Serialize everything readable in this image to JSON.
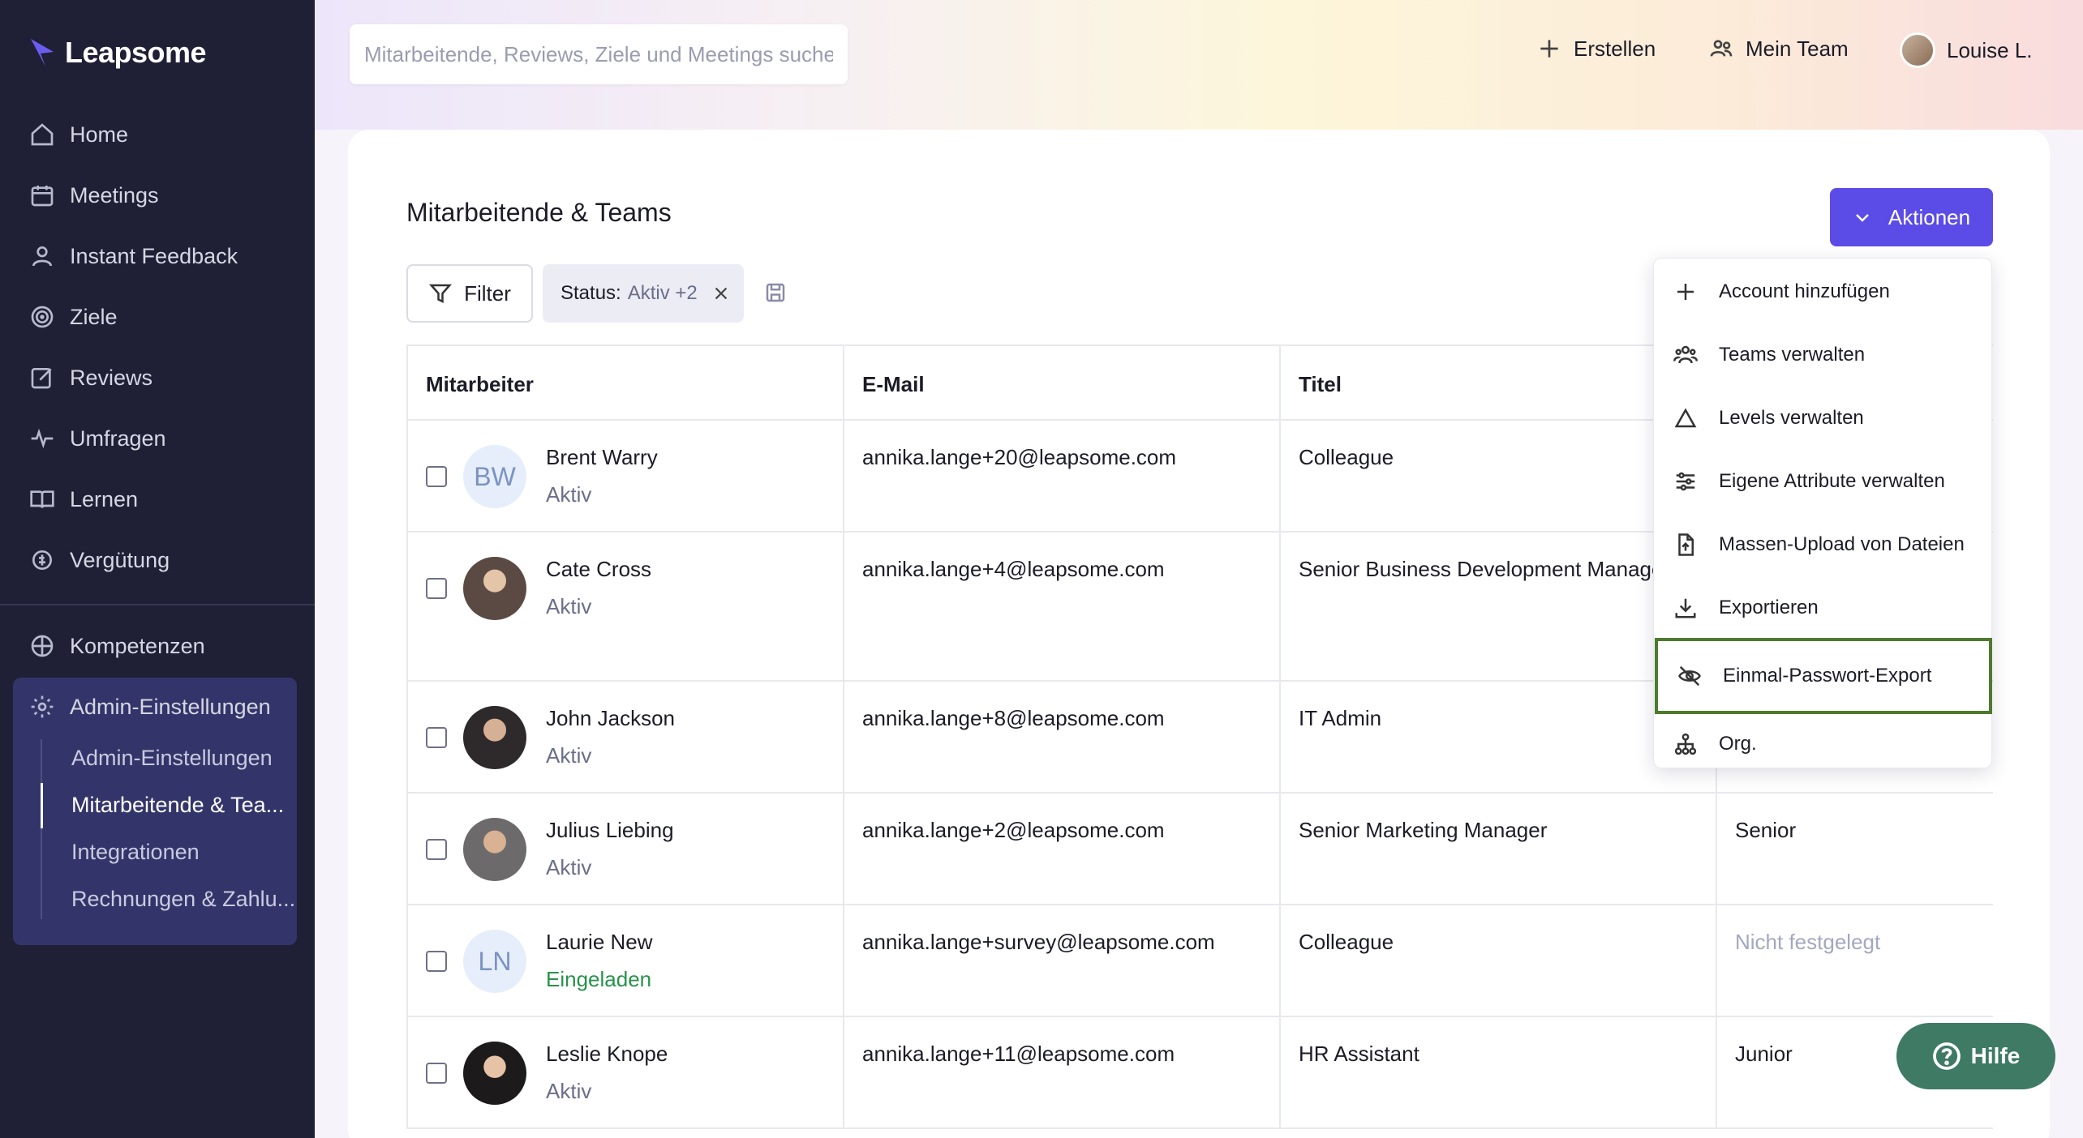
{
  "brand": {
    "name": "Leapsome"
  },
  "sidebar": {
    "items": [
      {
        "label": "Home"
      },
      {
        "label": "Meetings"
      },
      {
        "label": "Instant Feedback"
      },
      {
        "label": "Ziele"
      },
      {
        "label": "Reviews"
      },
      {
        "label": "Umfragen"
      },
      {
        "label": "Lernen"
      },
      {
        "label": "Vergütung"
      },
      {
        "label": "Kompetenzen"
      },
      {
        "label": "Admin-Einstellungen"
      }
    ],
    "sub_items": [
      {
        "label": "Admin-Einstellungen"
      },
      {
        "label": "Mitarbeitende & Tea..."
      },
      {
        "label": "Integrationen"
      },
      {
        "label": "Rechnungen & Zahlu..."
      }
    ]
  },
  "topbar": {
    "search_placeholder": "Mitarbeitende, Reviews, Ziele und Meetings suchen",
    "create_label": "Erstellen",
    "team_label": "Mein Team",
    "user_label": "Louise L."
  },
  "page": {
    "title": "Mitarbeitende & Teams",
    "actions_label": "Aktionen",
    "filter_label": "Filter",
    "chip_key": "Status:",
    "chip_value": "Aktiv +2"
  },
  "table": {
    "headers": [
      "Mitarbeiter",
      "E-Mail",
      "Titel"
    ],
    "rows": [
      {
        "initials": "BW",
        "name": "Brent Warry",
        "status": "Aktiv",
        "email": "annika.lange+20@leapsome.com",
        "title": "Colleague",
        "level": ""
      },
      {
        "initials": "",
        "name": "Cate Cross",
        "status": "Aktiv",
        "email": "annika.lange+4@leapsome.com",
        "title": "Senior Business Development Manager",
        "level": ""
      },
      {
        "initials": "",
        "name": "John Jackson",
        "status": "Aktiv",
        "email": "annika.lange+8@leapsome.com",
        "title": "IT Admin",
        "level": ""
      },
      {
        "initials": "",
        "name": "Julius Liebing",
        "status": "Aktiv",
        "email": "annika.lange+2@leapsome.com",
        "title": "Senior Marketing Manager",
        "level": "Senior"
      },
      {
        "initials": "LN",
        "name": "Laurie New",
        "status": "Eingeladen",
        "email": "annika.lange+survey@leapsome.com",
        "title": "Colleague",
        "level": "Nicht festgelegt"
      },
      {
        "initials": "",
        "name": "Leslie Knope",
        "status": "Aktiv",
        "email": "annika.lange+11@leapsome.com",
        "title": "HR Assistant",
        "level": "Junior"
      }
    ]
  },
  "dropdown": {
    "items": [
      {
        "label": "Account hinzufügen",
        "icon": "plus-icon"
      },
      {
        "label": "Teams verwalten",
        "icon": "users-icon"
      },
      {
        "label": "Levels verwalten",
        "icon": "triangle-icon"
      },
      {
        "label": "Eigene Attribute verwalten",
        "icon": "sliders-icon"
      },
      {
        "label": "Massen-Upload von Dateien",
        "icon": "file-upload-icon"
      },
      {
        "label": "Exportieren",
        "icon": "download-icon"
      },
      {
        "label": "Einmal-Passwort-Export",
        "icon": "eye-off-icon"
      },
      {
        "label": "Org.",
        "icon": "org-chart-icon"
      }
    ]
  },
  "help": {
    "label": "Hilfe"
  },
  "colors": {
    "sidebar": "#1f2036",
    "accent": "#5b4ce8",
    "help": "#3f7a65",
    "invited": "#27924a",
    "highlight_border": "#4d7a2c"
  }
}
